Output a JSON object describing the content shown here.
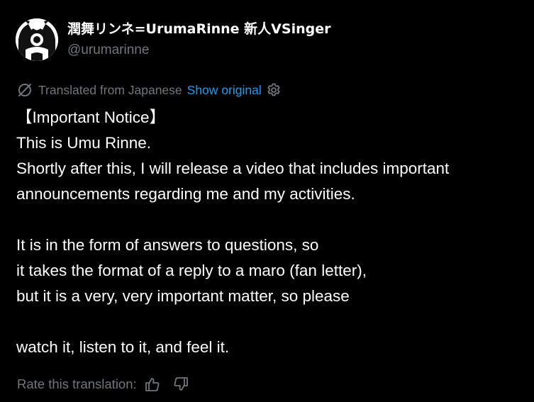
{
  "author": {
    "display_name": "潤舞リンネ=UrumaRinne 新人VSinger",
    "handle": "@urumarinne"
  },
  "translation": {
    "label": "Translated from Japanese",
    "show_original": "Show original"
  },
  "post": {
    "lines": [
      "【Important Notice】",
      "This is Umu Rinne.",
      "Shortly after this, I will release a video that includes important",
      "announcements regarding me and my activities.",
      "",
      "It is in the form of answers to questions, so",
      "it takes the format of a reply to a maro (fan letter),",
      "but it is a very, very important matter, so please",
      "",
      "watch it, listen to it, and feel it."
    ]
  },
  "rating": {
    "label": "Rate this translation:"
  },
  "icons": {
    "translate": "translate-icon",
    "settings": "gear-icon",
    "like": "thumbs-up-icon",
    "dislike": "thumbs-down-icon"
  },
  "colors": {
    "background": "#000000",
    "text": "#ffffff",
    "muted": "#71767b",
    "link": "#1d9bf0"
  }
}
